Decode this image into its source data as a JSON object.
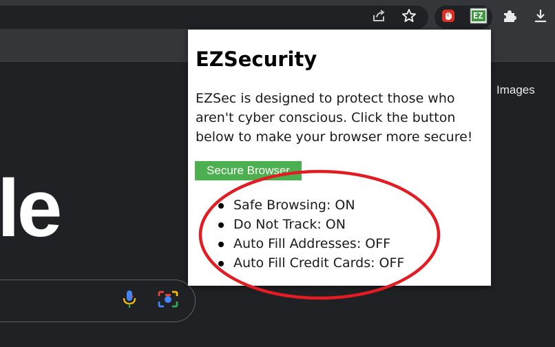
{
  "toolbar": {
    "icons": [
      "share-icon",
      "bookmark-star-icon",
      "stop-hand-extension-icon",
      "ezsecurity-extension-icon",
      "puzzle-extensions-icon",
      "download-icon"
    ],
    "ezsecurity_badge": "EZ"
  },
  "google": {
    "images_link": "Images",
    "logo_fragment": "le"
  },
  "popup": {
    "title": "EZSecurity",
    "description": "EZSec is designed to protect those who aren't cyber conscious. Click the button below to make your browser more secure!",
    "button_label": "Secure Browser",
    "status_items": [
      "Safe Browsing: ON",
      "Do Not Track: ON",
      "Auto Fill Addresses: OFF",
      "Auto Fill Credit Cards: OFF"
    ]
  },
  "colors": {
    "button": "#4caf50",
    "annotation": "#e31b23",
    "page_background": "#202124"
  }
}
